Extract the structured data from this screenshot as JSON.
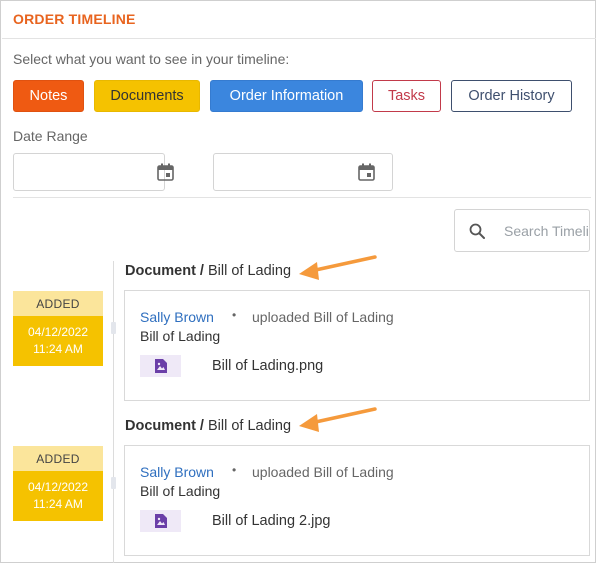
{
  "header": {
    "title": "ORDER TIMELINE"
  },
  "filters": {
    "prompt": "Select what you want to see in your timeline:",
    "buttons": [
      {
        "label": "Notes",
        "color": "#ef5a12"
      },
      {
        "label": "Documents",
        "color": "#f5c200"
      },
      {
        "label": "Order Information",
        "color": "#3b86de"
      },
      {
        "label": "Tasks",
        "color": "#c23a4a"
      },
      {
        "label": "Order History",
        "color": "#3e4f6e"
      }
    ]
  },
  "date_range": {
    "label": "Date Range",
    "from": {
      "value": "",
      "icon": "calendar-icon"
    },
    "to": {
      "value": "",
      "icon": "calendar-icon"
    }
  },
  "search": {
    "placeholder": "Search Timeline",
    "icon": "search-icon"
  },
  "entries": [
    {
      "badge": "ADDED",
      "date": "04/12/2022",
      "time": "11:24 AM",
      "type": "Document /",
      "subtype": "Bill of Lading",
      "user": "Sally Brown",
      "separator": "•",
      "action": "uploaded Bill of Lading",
      "description": "Bill of Lading",
      "file_name": "Bill of Lading.png",
      "file_icon": "image-file-icon"
    },
    {
      "badge": "ADDED",
      "date": "04/12/2022",
      "time": "11:24 AM",
      "type": "Document /",
      "subtype": "Bill of Lading",
      "user": "Sally Brown",
      "separator": "•",
      "action": "uploaded Bill of Lading",
      "description": "Bill of Lading",
      "file_name": "Bill of Lading 2.jpg",
      "file_icon": "image-file-icon"
    }
  ],
  "annotation": {
    "arrow_color": "#f59a3c"
  }
}
